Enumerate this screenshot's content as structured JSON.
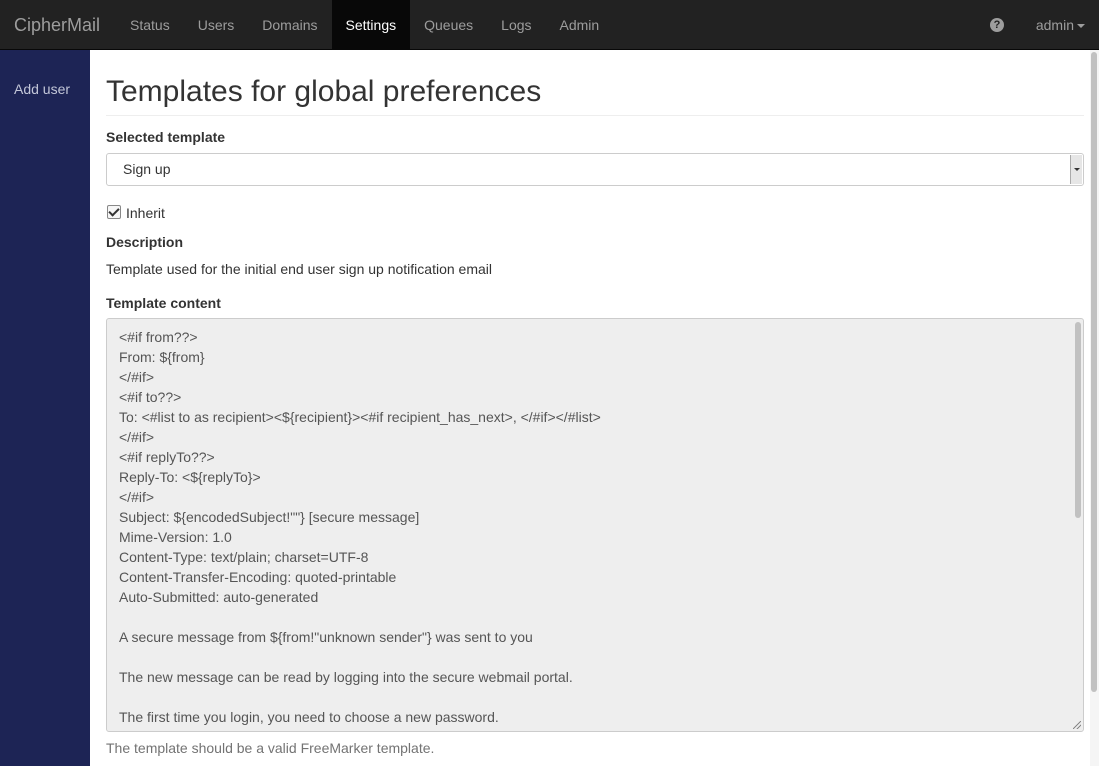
{
  "navbar": {
    "brand": "CipherMail",
    "items": [
      {
        "label": "Status",
        "active": false
      },
      {
        "label": "Users",
        "active": false
      },
      {
        "label": "Domains",
        "active": false
      },
      {
        "label": "Settings",
        "active": true
      },
      {
        "label": "Queues",
        "active": false
      },
      {
        "label": "Logs",
        "active": false
      },
      {
        "label": "Admin",
        "active": false
      }
    ],
    "help_icon": "question-circle-icon",
    "help_glyph": "?",
    "user": "admin"
  },
  "sidebar": {
    "items": [
      {
        "label": "Add user"
      }
    ]
  },
  "main": {
    "title": "Templates for global preferences",
    "selected_template_label": "Selected template",
    "selected_template_value": "Sign up",
    "inherit_label": "Inherit",
    "inherit_checked": true,
    "description_label": "Description",
    "description_text": "Template used for the initial end user sign up notification email",
    "template_content_label": "Template content",
    "template_content": "<#if from??>\nFrom: ${from}\n</#if>\n<#if to??>\nTo: <#list to as recipient><${recipient}><#if recipient_has_next>, </#if></#list>\n</#if>\n<#if replyTo??>\nReply-To: <${replyTo}>\n</#if>\nSubject: ${encodedSubject!\"\"} [secure message]\nMime-Version: 1.0\nContent-Type: text/plain; charset=UTF-8\nContent-Transfer-Encoding: quoted-printable\nAuto-Submitted: auto-generated\n\nA secure message from ${from!\"unknown sender\"} was sent to you\n\nThe new message can be read by logging into the secure webmail portal.\n\nThe first time you login, you need to choose a new password.",
    "help_text": "The template should be a valid FreeMarker template."
  },
  "colors": {
    "navbar_bg": "#222222",
    "navbar_active_bg": "#080808",
    "sidebar_bg": "#1d2455",
    "textarea_bg": "#eeeeee"
  }
}
